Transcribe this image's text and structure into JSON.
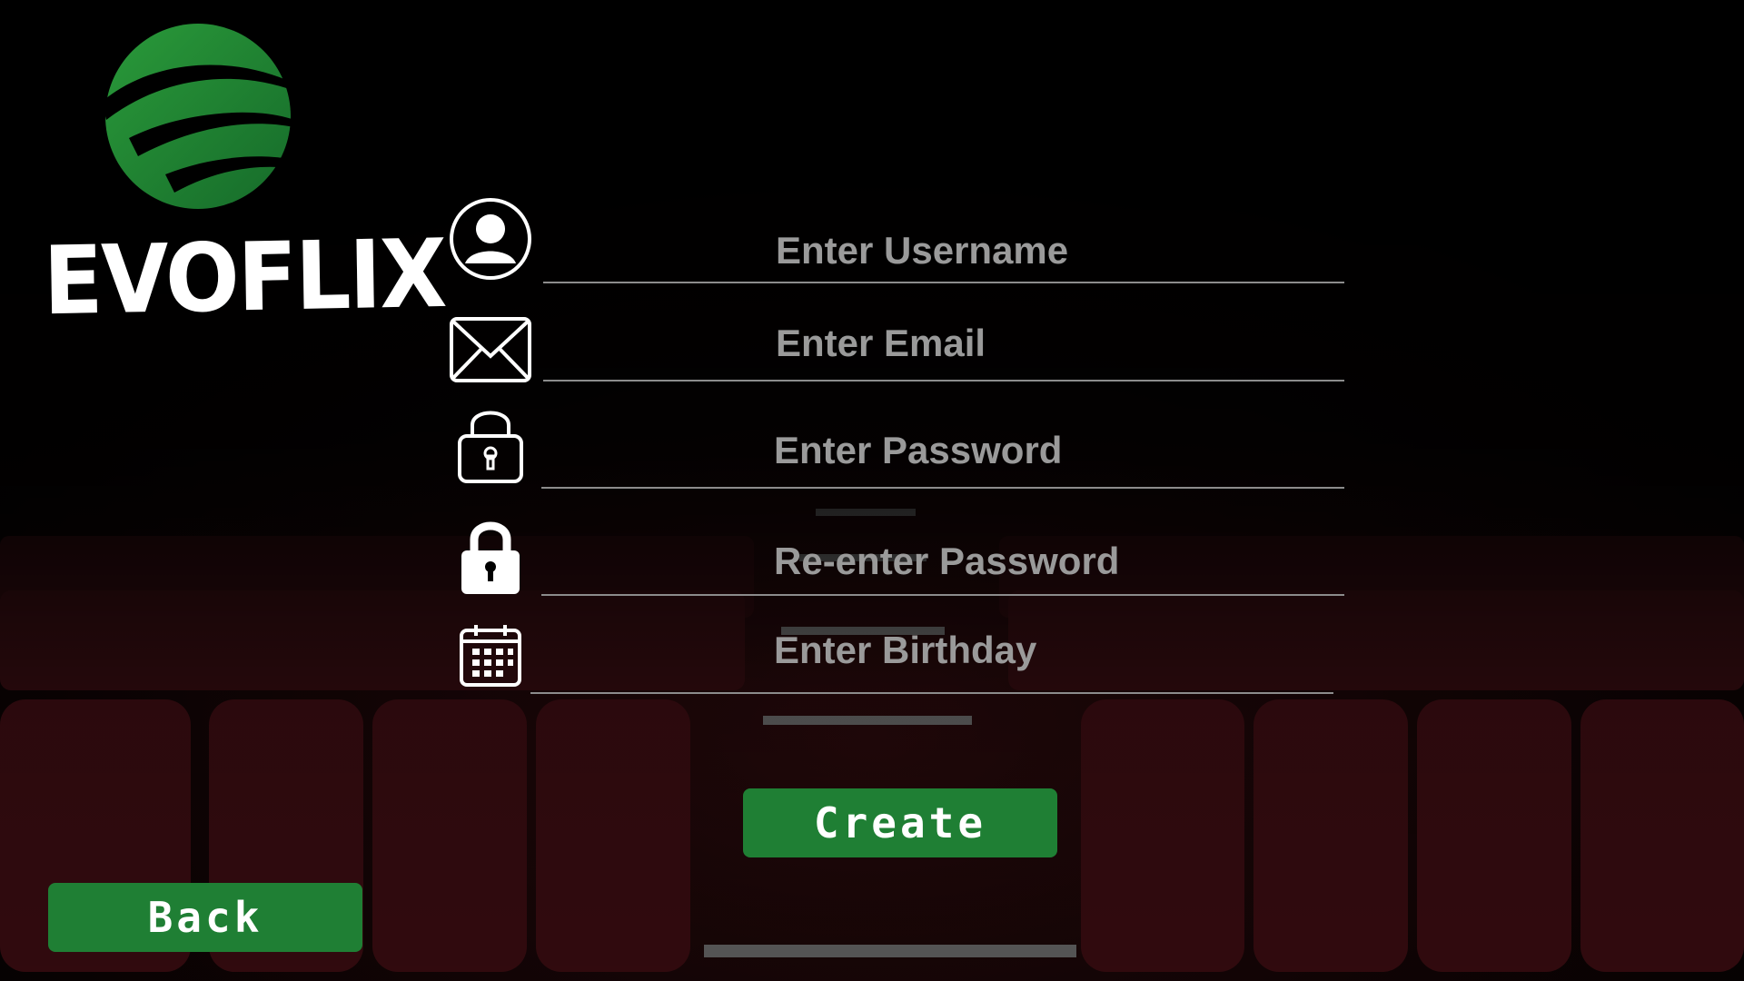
{
  "app": {
    "brand_name": "EVOFLIX"
  },
  "form": {
    "fields": [
      {
        "icon": "user-icon",
        "placeholder": "Enter Username",
        "value": ""
      },
      {
        "icon": "envelope-icon",
        "placeholder": "Enter Email",
        "value": ""
      },
      {
        "icon": "lock-open-outline-icon",
        "placeholder": "Enter Password",
        "value": ""
      },
      {
        "icon": "lock-filled-icon",
        "placeholder": "Re-enter Password",
        "value": ""
      },
      {
        "icon": "calendar-icon",
        "placeholder": "Enter Birthday",
        "value": ""
      }
    ],
    "create_label": "Create"
  },
  "nav": {
    "back_label": "Back"
  },
  "colors": {
    "accent_green": "#1f7f34",
    "background": "#000000",
    "seat_red": "#3a0c10"
  },
  "background": {
    "scene": "theater-seats-image"
  }
}
